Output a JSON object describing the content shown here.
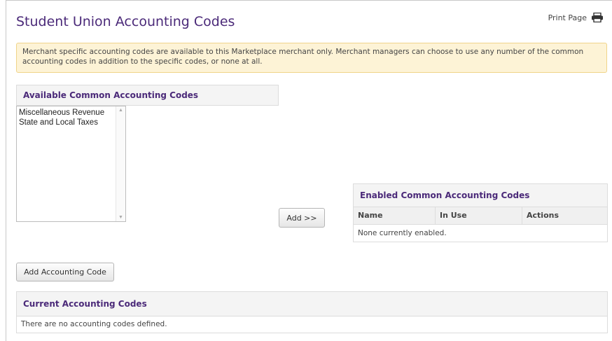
{
  "page": {
    "title": "Student Union Accounting Codes",
    "print_label": "Print Page"
  },
  "notice": {
    "text": "Merchant specific accounting codes are available to this Marketplace merchant only. Merchant managers can choose to use any number of the common accounting codes in addition to the specific codes, or none at all."
  },
  "available": {
    "header": "Available Common Accounting Codes",
    "items": [
      "Miscellaneous Revenue",
      "State and Local Taxes"
    ]
  },
  "add_button": "Add >>",
  "enabled": {
    "header": "Enabled Common Accounting Codes",
    "columns": [
      "Name",
      "In Use",
      "Actions"
    ],
    "empty_text": "None currently enabled."
  },
  "add_code_button": "Add Accounting Code",
  "current": {
    "header": "Current Accounting Codes",
    "empty_text": "There are no accounting codes defined."
  },
  "colors": {
    "accent": "#4b2a79",
    "notice_bg": "#fdf3d6",
    "notice_border": "#f0d48a"
  },
  "icons": {
    "print": "printer-icon"
  }
}
